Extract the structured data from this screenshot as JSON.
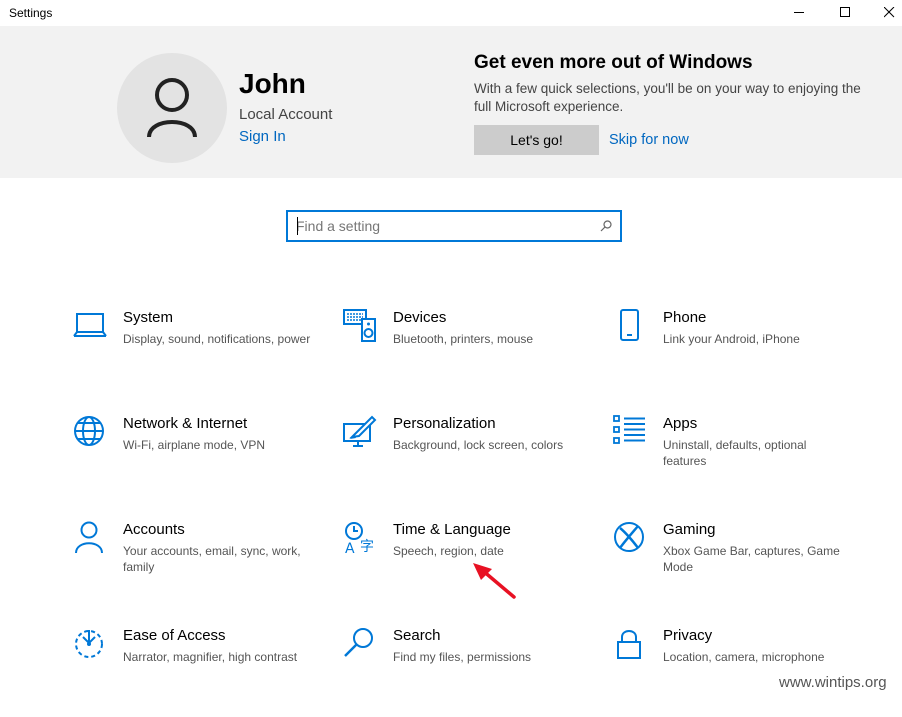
{
  "window": {
    "title": "Settings",
    "minimize_icon": "minimize-icon",
    "maximize_icon": "maximize-icon",
    "close_icon": "close-icon"
  },
  "account": {
    "name": "John",
    "type": "Local Account",
    "sign_in": "Sign In",
    "avatar_icon": "person-icon"
  },
  "promo": {
    "title": "Get even more out of Windows",
    "text": "With a few quick selections, you'll be on your way to enjoying the full Microsoft experience.",
    "primary_button": "Let's go!",
    "secondary_link": "Skip for now"
  },
  "search": {
    "placeholder": "Find a setting",
    "value": ""
  },
  "tiles": [
    {
      "title": "System",
      "desc": "Display, sound, notifications, power",
      "icon": "laptop-icon"
    },
    {
      "title": "Devices",
      "desc": "Bluetooth, printers, mouse",
      "icon": "devices-icon"
    },
    {
      "title": "Phone",
      "desc": "Link your Android, iPhone",
      "icon": "phone-icon"
    },
    {
      "title": "Network & Internet",
      "desc": "Wi-Fi, airplane mode, VPN",
      "icon": "globe-icon"
    },
    {
      "title": "Personalization",
      "desc": "Background, lock screen, colors",
      "icon": "personalization-icon"
    },
    {
      "title": "Apps",
      "desc": "Uninstall, defaults, optional features",
      "icon": "apps-list-icon"
    },
    {
      "title": "Accounts",
      "desc": "Your accounts, email, sync, work, family",
      "icon": "person-icon"
    },
    {
      "title": "Time & Language",
      "desc": "Speech, region, date",
      "icon": "time-language-icon"
    },
    {
      "title": "Gaming",
      "desc": "Xbox Game Bar, captures, Game Mode",
      "icon": "xbox-icon"
    },
    {
      "title": "Ease of Access",
      "desc": "Narrator, magnifier, high contrast",
      "icon": "ease-of-access-icon"
    },
    {
      "title": "Search",
      "desc": "Find my files, permissions",
      "icon": "magnifier-icon"
    },
    {
      "title": "Privacy",
      "desc": "Location, camera, microphone",
      "icon": "lock-icon"
    }
  ],
  "annotation": {
    "icon": "red-arrow-icon"
  },
  "watermark": "www.wintips.org",
  "colors": {
    "accent": "#0078d7",
    "link": "#0067c0",
    "banner_bg": "#f2f2f2",
    "arrow": "#e81123"
  }
}
